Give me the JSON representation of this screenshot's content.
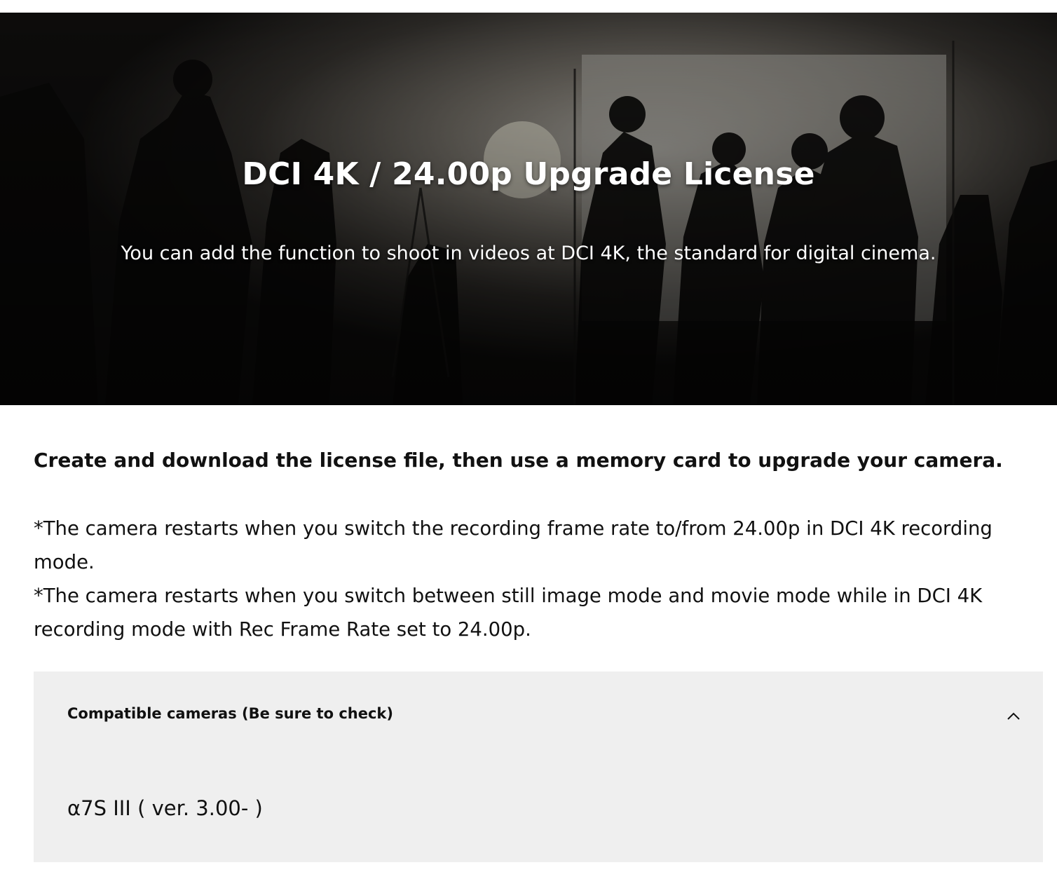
{
  "hero": {
    "title": "DCI 4K / 24.00p Upgrade License",
    "subtitle": "You can add the function to shoot in videos at DCI 4K, the standard for digital cinema."
  },
  "intro": {
    "lead": "Create and download the license file, then use a memory card to upgrade your camera.",
    "notes": [
      "*The camera restarts when you switch the recording frame rate to/from 24.00p in DCI 4K recording mode.",
      "*The camera restarts when you switch between still image mode and movie mode while in DCI 4K recording mode with Rec Frame Rate set to 24.00p."
    ]
  },
  "compatible": {
    "title": "Compatible cameras (Be sure to check)",
    "expanded": true,
    "toggle_icon": "chevron-up-icon",
    "cameras": [
      "α7S III ( ver. 3.00- )"
    ]
  },
  "colors": {
    "accordion_bg": "#efefef",
    "text": "#111111",
    "hero_text": "#ffffff"
  }
}
